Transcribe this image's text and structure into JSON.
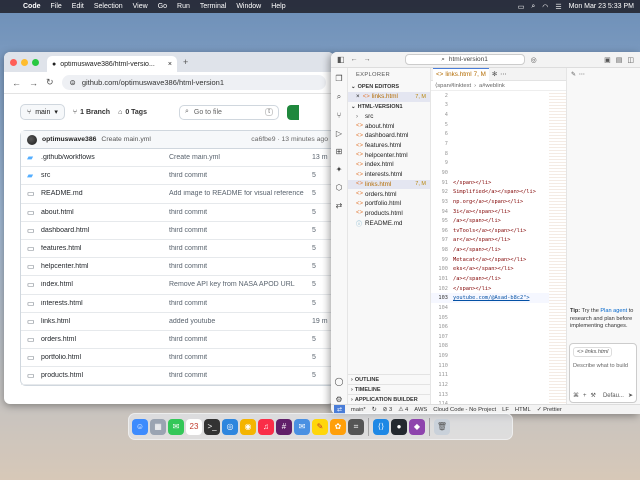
{
  "menubar": {
    "app": "Code",
    "items": [
      "File",
      "Edit",
      "Selection",
      "View",
      "Go",
      "Run",
      "Terminal",
      "Window",
      "Help"
    ],
    "datetime": "Mon Mar 23  5:33 PM"
  },
  "browser": {
    "tab_title": "optimuswave386/html-versio...",
    "url": "github.com/optimuswave386/html-version1",
    "branch": "main",
    "branches": "1 Branch",
    "tags": "0 Tags",
    "goto_placeholder": "Go to file",
    "goto_key": "t",
    "commit": {
      "author": "optimuswave386",
      "message": "Create main.yml",
      "meta": "ca6fbe9 · 13 minutes ago"
    },
    "files": [
      {
        "type": "dir",
        "name": ".github/workflows",
        "message": "Create main.yml",
        "date": "13 m"
      },
      {
        "type": "dir",
        "name": "src",
        "message": "third commit",
        "date": "5"
      },
      {
        "type": "file",
        "name": "README.md",
        "message": "Add image to README for visual reference",
        "date": "5"
      },
      {
        "type": "file",
        "name": "about.html",
        "message": "third commit",
        "date": "5"
      },
      {
        "type": "file",
        "name": "dashboard.html",
        "message": "third commit",
        "date": "5"
      },
      {
        "type": "file",
        "name": "features.html",
        "message": "third commit",
        "date": "5"
      },
      {
        "type": "file",
        "name": "helpcenter.html",
        "message": "third commit",
        "date": "5"
      },
      {
        "type": "file",
        "name": "index.html",
        "message": "Remove API key from NASA APOD URL",
        "date": "5"
      },
      {
        "type": "file",
        "name": "interests.html",
        "message": "third commit",
        "date": "5"
      },
      {
        "type": "file",
        "name": "links.html",
        "message": "added youtube",
        "date": "19 m"
      },
      {
        "type": "file",
        "name": "orders.html",
        "message": "third commit",
        "date": "5"
      },
      {
        "type": "file",
        "name": "portfolio.html",
        "message": "third commit",
        "date": "5"
      },
      {
        "type": "file",
        "name": "products.html",
        "message": "third commit",
        "date": "5"
      }
    ]
  },
  "vscode": {
    "search": "html-version1",
    "explorer_title": "EXPLORER",
    "open_editors": "OPEN EDITORS",
    "open_file": "links.html",
    "open_file_badge": "7, M",
    "project": "HTML-VERSION1",
    "tree": [
      {
        "name": "src",
        "kind": "dir",
        "badge": ""
      },
      {
        "name": "about.html",
        "kind": "html",
        "badge": ""
      },
      {
        "name": "dashboard.html",
        "kind": "html",
        "badge": ""
      },
      {
        "name": "features.html",
        "kind": "html",
        "badge": ""
      },
      {
        "name": "helpcenter.html",
        "kind": "html",
        "badge": ""
      },
      {
        "name": "index.html",
        "kind": "html",
        "badge": ""
      },
      {
        "name": "interests.html",
        "kind": "html",
        "badge": ""
      },
      {
        "name": "links.html",
        "kind": "html",
        "badge": "7, M"
      },
      {
        "name": "orders.html",
        "kind": "html",
        "badge": ""
      },
      {
        "name": "portfolio.html",
        "kind": "html",
        "badge": ""
      },
      {
        "name": "products.html",
        "kind": "html",
        "badge": ""
      },
      {
        "name": "README.md",
        "kind": "md",
        "badge": ""
      }
    ],
    "outline": "OUTLINE",
    "timeline": "TIMELINE",
    "app_builder": "APPLICATION BUILDER",
    "editor_tab": "links.html",
    "editor_tab_badge": "7, M",
    "breadcrumb": "⟨span#linktext",
    "breadcrumb_tail": "a#weblink",
    "lines": [
      {
        "no": "2",
        "code": ""
      },
      {
        "no": "3",
        "code": ""
      },
      {
        "no": "4",
        "code": ""
      },
      {
        "no": "5",
        "code": ""
      },
      {
        "no": "6",
        "code": ""
      },
      {
        "no": "7",
        "code": ""
      },
      {
        "no": "8",
        "code": ""
      },
      {
        "no": "9",
        "code": ""
      },
      {
        "no": "90",
        "code": ""
      },
      {
        "no": "91",
        "code": "</span></li>"
      },
      {
        "no": "92",
        "code": "Simplified</a></span></li>"
      },
      {
        "no": "93",
        "code": "np.org</a></span></li>"
      },
      {
        "no": "94",
        "code": "3i</a></span></li>"
      },
      {
        "no": "95",
        "code": "/a></span></li>"
      },
      {
        "no": "96",
        "code": "tvTools</a></span></li>"
      },
      {
        "no": "97",
        "code": "ar</a></span></li>"
      },
      {
        "no": "98",
        "code": "/a></span></li>"
      },
      {
        "no": "99",
        "code": "Metacat</a></span></li>"
      },
      {
        "no": "100",
        "code": "eks</a></span></li>"
      },
      {
        "no": "101",
        "code": "/a></span></li>"
      },
      {
        "no": "102",
        "code": "</span></li>"
      },
      {
        "no": "103",
        "code": "youtube.com/@Asad-b8c2\">"
      },
      {
        "no": "104",
        "code": ""
      },
      {
        "no": "105",
        "code": ""
      },
      {
        "no": "106",
        "code": ""
      },
      {
        "no": "107",
        "code": ""
      },
      {
        "no": "108",
        "code": ""
      },
      {
        "no": "109",
        "code": ""
      },
      {
        "no": "110",
        "code": ""
      },
      {
        "no": "111",
        "code": ""
      },
      {
        "no": "112",
        "code": ""
      },
      {
        "no": "113",
        "code": ""
      },
      {
        "no": "114",
        "code": ""
      },
      {
        "no": "115",
        "code": ""
      },
      {
        "no": "116",
        "code": ""
      },
      {
        "no": "117",
        "code": ""
      },
      {
        "no": "118",
        "code": ""
      },
      {
        "no": "119",
        "code": ""
      },
      {
        "no": "120",
        "code": ""
      },
      {
        "no": "121",
        "code": ""
      },
      {
        "no": "122",
        "code": "0 0 .5.5H4a.5.5 0 0 0 .5"
      }
    ],
    "chat_tip_bold": "Tip:",
    "chat_tip_1": "Try the",
    "chat_tip_link": "Plan agent",
    "chat_tip_2": "to research and plan before implementing changes.",
    "chat_file": "links.html",
    "chat_placeholder": "Describe what to build",
    "chat_mode": "Defau...",
    "status": {
      "branch": "main*",
      "errors": "⊘ 3",
      "warnings": "⚠ 4",
      "aws": "AWS",
      "cloud": "Cloud Code - No Project",
      "eol": "LF",
      "lang": "HTML",
      "prettier": "✓ Prettier"
    }
  },
  "dock_apps": [
    "finder-icon",
    "launchpad-icon",
    "messages-icon",
    "calendar-icon",
    "terminal-icon",
    "safari-icon",
    "chrome-icon",
    "music-icon",
    "slack-icon",
    "mail-icon",
    "notes-icon",
    "photos-icon",
    "calculator-icon",
    "vscode-icon",
    "github-icon",
    "app-icon"
  ]
}
